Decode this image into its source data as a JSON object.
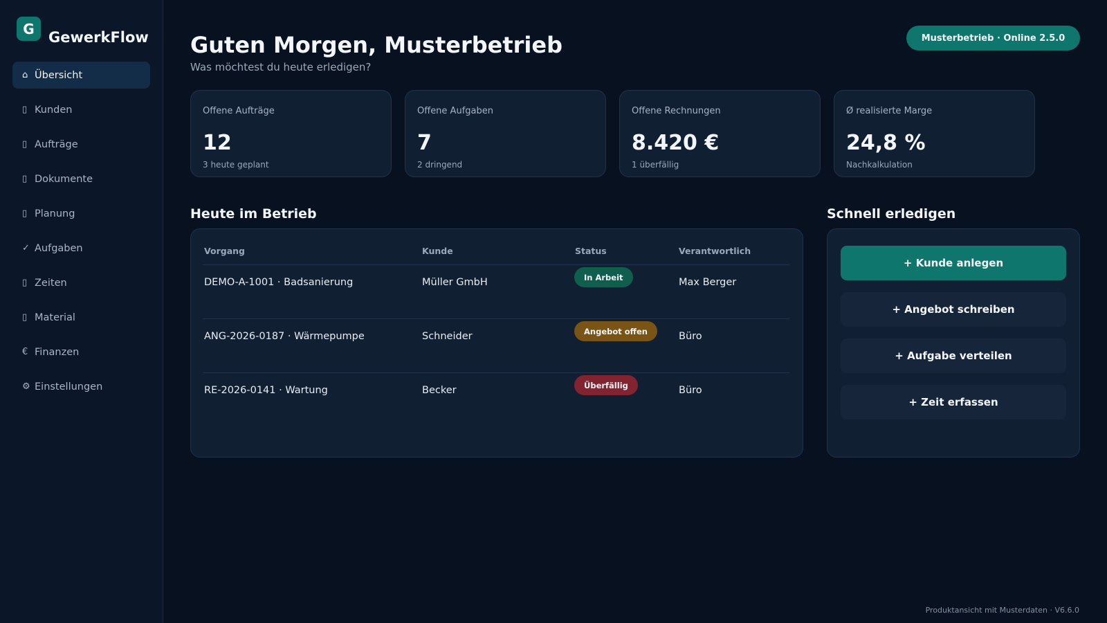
{
  "brand": {
    "logo_letter": "G",
    "name": "GewerkFlow"
  },
  "sidebar": {
    "items": [
      {
        "icon": "⌂",
        "icon_name": "home-icon",
        "label": "Übersicht",
        "active": true
      },
      {
        "icon": "▯",
        "icon_name": "customers-icon",
        "label": "Kunden"
      },
      {
        "icon": "▯",
        "icon_name": "orders-icon",
        "label": "Aufträge"
      },
      {
        "icon": "▯",
        "icon_name": "documents-icon",
        "label": "Dokumente"
      },
      {
        "icon": "▯",
        "icon_name": "calendar-icon",
        "label": "Planung"
      },
      {
        "icon": "✓",
        "icon_name": "check-icon",
        "label": "Aufgaben"
      },
      {
        "icon": "▯",
        "icon_name": "clock-icon",
        "label": "Zeiten"
      },
      {
        "icon": "▯",
        "icon_name": "material-icon",
        "label": "Material"
      },
      {
        "icon": "€",
        "icon_name": "euro-icon",
        "label": "Finanzen"
      },
      {
        "icon": "⚙",
        "icon_name": "gear-icon",
        "label": "Einstellungen"
      }
    ]
  },
  "header": {
    "greeting": "Guten Morgen, Musterbetrieb",
    "subtitle": "Was möchtest du heute erledigen?",
    "status_pill": "Musterbetrieb · Online 2.5.0"
  },
  "kpis": [
    {
      "label": "Offene Aufträge",
      "value": "12",
      "sub": "3 heute geplant"
    },
    {
      "label": "Offene Aufgaben",
      "value": "7",
      "sub": "2 dringend"
    },
    {
      "label": "Offene Rechnungen",
      "value": "8.420 €",
      "sub": "1 überfällig"
    },
    {
      "label": "Ø realisierte Marge",
      "value": "24,8 %",
      "sub": "Nachkalkulation"
    }
  ],
  "today": {
    "title": "Heute im Betrieb",
    "columns": [
      "Vorgang",
      "Kunde",
      "Status",
      "Verantwortlich"
    ],
    "rows": [
      {
        "vorgang": "DEMO-A-1001 · Badsanierung",
        "kunde": "Müller GmbH",
        "status": "In Arbeit",
        "verantwortlich": "Max Berger"
      },
      {
        "vorgang": "ANG-2026-0187 · Wärmepumpe",
        "kunde": "Schneider",
        "status": "Angebot offen",
        "verantwortlich": "Büro"
      },
      {
        "vorgang": "RE-2026-0141 · Wartung",
        "kunde": "Becker",
        "status": "Überfällig",
        "verantwortlich": "Büro"
      }
    ]
  },
  "quick": {
    "title": "Schnell erledigen",
    "buttons": [
      "+ Kunde anlegen",
      "+ Angebot schreiben",
      "+ Aufgabe verteilen",
      "+ Zeit erfassen"
    ]
  },
  "footer": "Produktansicht mit Musterdaten · V6.6.0",
  "colors": {
    "accent": "#0f766e",
    "status_in_arbeit": "#0f5e4e",
    "status_angebot_offen": "#7a5414",
    "status_ueberfaellig": "#82242f"
  }
}
